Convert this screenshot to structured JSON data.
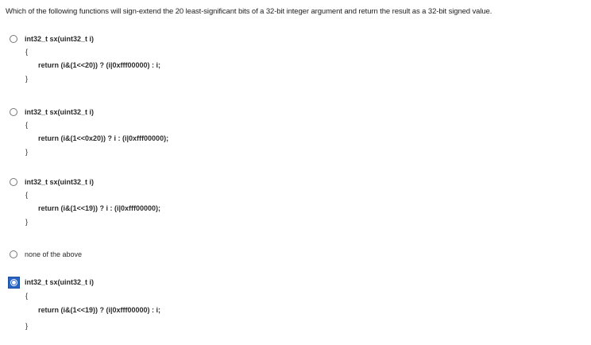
{
  "question": {
    "text": "Which of the following functions will sign-extend the 20 least-significant bits of a 32-bit integer argument and return the result as a 32-bit signed value."
  },
  "options": [
    {
      "signature": "int32_t sx(uint32_t i)",
      "open_brace": "{",
      "body": "return (i&(1<<20)) ? (i|0xfff00000) : i;",
      "close_brace": "}",
      "selected": false
    },
    {
      "signature": "int32_t sx(uint32_t i)",
      "open_brace": "{",
      "body": "return (i&(1<<0x20)) ? i : (i|0xfff00000);",
      "close_brace": "}",
      "selected": false
    },
    {
      "signature": "int32_t sx(uint32_t i)",
      "open_brace": "{",
      "body": "return (i&(1<<19)) ? i : (i|0xfff00000);",
      "close_brace": "}",
      "selected": false
    },
    {
      "label": "none of the above",
      "selected": false
    },
    {
      "signature": "int32_t sx(uint32_t i)",
      "open_brace": "{",
      "body": "return (i&(1<<19)) ? (i|0xfff00000) : i;",
      "close_brace": "}",
      "selected": true
    }
  ],
  "colors": {
    "selected_accent": "#2a63c4",
    "text": "#2b2b2b"
  },
  "icons": {
    "radio": "radio-button-icon",
    "radio_selected": "radio-button-selected-icon"
  }
}
